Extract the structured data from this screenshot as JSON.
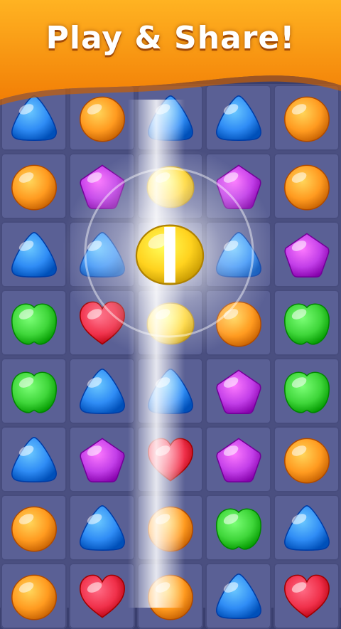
{
  "banner": {
    "title": "Play & Share!"
  },
  "board": {
    "columns": 5,
    "rows": [
      [
        "triangle-blue",
        "round-orange",
        "triangle-blue",
        "triangle-blue",
        "round-orange"
      ],
      [
        "round-orange",
        "pentagon-purple",
        "lemon-yellow",
        "pentagon-purple",
        "round-orange"
      ],
      [
        "triangle-blue",
        "triangle-blue",
        "lemon-yellow",
        "triangle-blue",
        "pentagon-purple"
      ],
      [
        "apple-green",
        "heart-red",
        "lemon-yellow",
        "round-orange",
        "apple-green"
      ],
      [
        "apple-green",
        "triangle-blue",
        "triangle-blue",
        "pentagon-purple",
        "apple-green"
      ],
      [
        "triangle-blue",
        "pentagon-purple",
        "heart-red",
        "pentagon-purple",
        "round-orange"
      ],
      [
        "round-orange",
        "triangle-blue",
        "round-orange",
        "apple-green",
        "triangle-blue"
      ],
      [
        "round-orange",
        "heart-red",
        "round-orange",
        "triangle-blue",
        "heart-red"
      ]
    ],
    "special_candy": {
      "type": "lemon-yellow-striped-vertical",
      "row": 2,
      "col": 2
    },
    "effect": "vertical-blast-column-2"
  },
  "colors": {
    "orange": "#ff9a1f",
    "blue": "#2f8cf5",
    "purple": "#c23ee8",
    "green": "#3fd63a",
    "red": "#f0304a",
    "yellow": "#ffd21e",
    "banner": "#ff9f14",
    "board": "#4a4f80",
    "cell": "#5a6095"
  }
}
